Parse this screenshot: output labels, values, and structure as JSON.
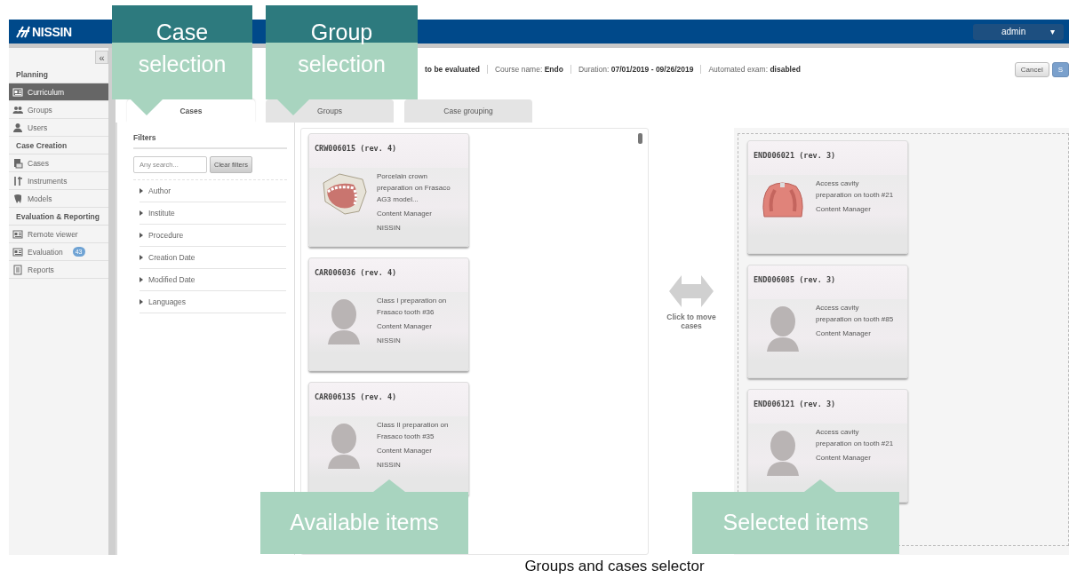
{
  "header": {
    "logo": "NISSIN",
    "user": "admin",
    "user_caret": "▾"
  },
  "sidebar": {
    "collapse": "«",
    "sections": [
      {
        "title": "Planning",
        "items": [
          {
            "label": "Curriculum",
            "kind": "card",
            "selected": true
          },
          {
            "label": "Groups",
            "kind": "group",
            "selected": false
          },
          {
            "label": "Users",
            "kind": "user",
            "selected": false
          }
        ]
      },
      {
        "title": "Case Creation",
        "items": [
          {
            "label": "Cases",
            "kind": "cases",
            "selected": false
          },
          {
            "label": "Instruments",
            "kind": "instruments",
            "selected": false
          },
          {
            "label": "Models",
            "kind": "tooth",
            "selected": false
          }
        ]
      },
      {
        "title": "Evaluation & Reporting",
        "items": [
          {
            "label": "Remote viewer",
            "kind": "card",
            "selected": false
          },
          {
            "label": "Evaluation",
            "kind": "card",
            "selected": false,
            "badge": "43"
          },
          {
            "label": "Reports",
            "kind": "document",
            "selected": false
          }
        ]
      }
    ]
  },
  "info_bar": {
    "status_tail": "to be evaluated",
    "items": [
      {
        "label": "Course name:",
        "value": "Endo"
      },
      {
        "label": "Duration:",
        "value": "07/01/2019 - 09/26/2019"
      },
      {
        "label": "Automated exam:",
        "value": "disabled"
      }
    ],
    "buttons": [
      {
        "label": "Cancel",
        "kind": "plain"
      },
      {
        "label": "S",
        "kind": "primary"
      }
    ]
  },
  "tabs": [
    {
      "label": "Cases",
      "selected": true
    },
    {
      "label": "Groups",
      "selected": false
    },
    {
      "label": "Case grouping",
      "selected": false
    }
  ],
  "filters": {
    "title": "Filters",
    "placeholder": "Any search...",
    "clear_button": "Clear filters",
    "groups": [
      "Author",
      "Institute",
      "Procedure",
      "Creation Date",
      "Modified Date",
      "Languages"
    ]
  },
  "available": [
    {
      "title": "CRW006015 (rev. 4)",
      "kind": "dental-model",
      "description": "Porcelain crown preparation on Frasaco AG3 model...",
      "author": [
        "Content Manager",
        "NISSIN"
      ]
    },
    {
      "title": "CAR006036 (rev. 4)",
      "kind": "avatar",
      "description": "Class I preparation on Frasaco tooth #36",
      "author": [
        "Content Manager",
        "NISSIN"
      ]
    },
    {
      "title": "CAR006135 (rev. 4)",
      "kind": "avatar",
      "description": "Class II preparation on Frasaco tooth #35",
      "author": [
        "Content Manager",
        "NISSIN"
      ]
    }
  ],
  "move_hint": "Click to move cases",
  "selected": [
    {
      "title": "END006021 (rev. 3)",
      "kind": "upper-jaw",
      "description": "Access cavity preparation on tooth #21",
      "author": [
        "Content Manager"
      ]
    },
    {
      "title": "END006085 (rev. 3)",
      "kind": "avatar",
      "description": "Access cavity preparation on tooth #85",
      "author": [
        "Content Manager"
      ]
    },
    {
      "title": "END006121 (rev. 3)",
      "kind": "avatar",
      "description": "Access cavity preparation on tooth #21",
      "author": [
        "Content Manager"
      ]
    }
  ],
  "callouts": [
    {
      "title": "Case selection",
      "kind": "down"
    },
    {
      "title": "Group selection",
      "kind": "down"
    },
    {
      "title": "Available items",
      "kind": "up"
    },
    {
      "title": "Selected items",
      "kind": "up"
    }
  ],
  "caption": "Groups and cases selector"
}
